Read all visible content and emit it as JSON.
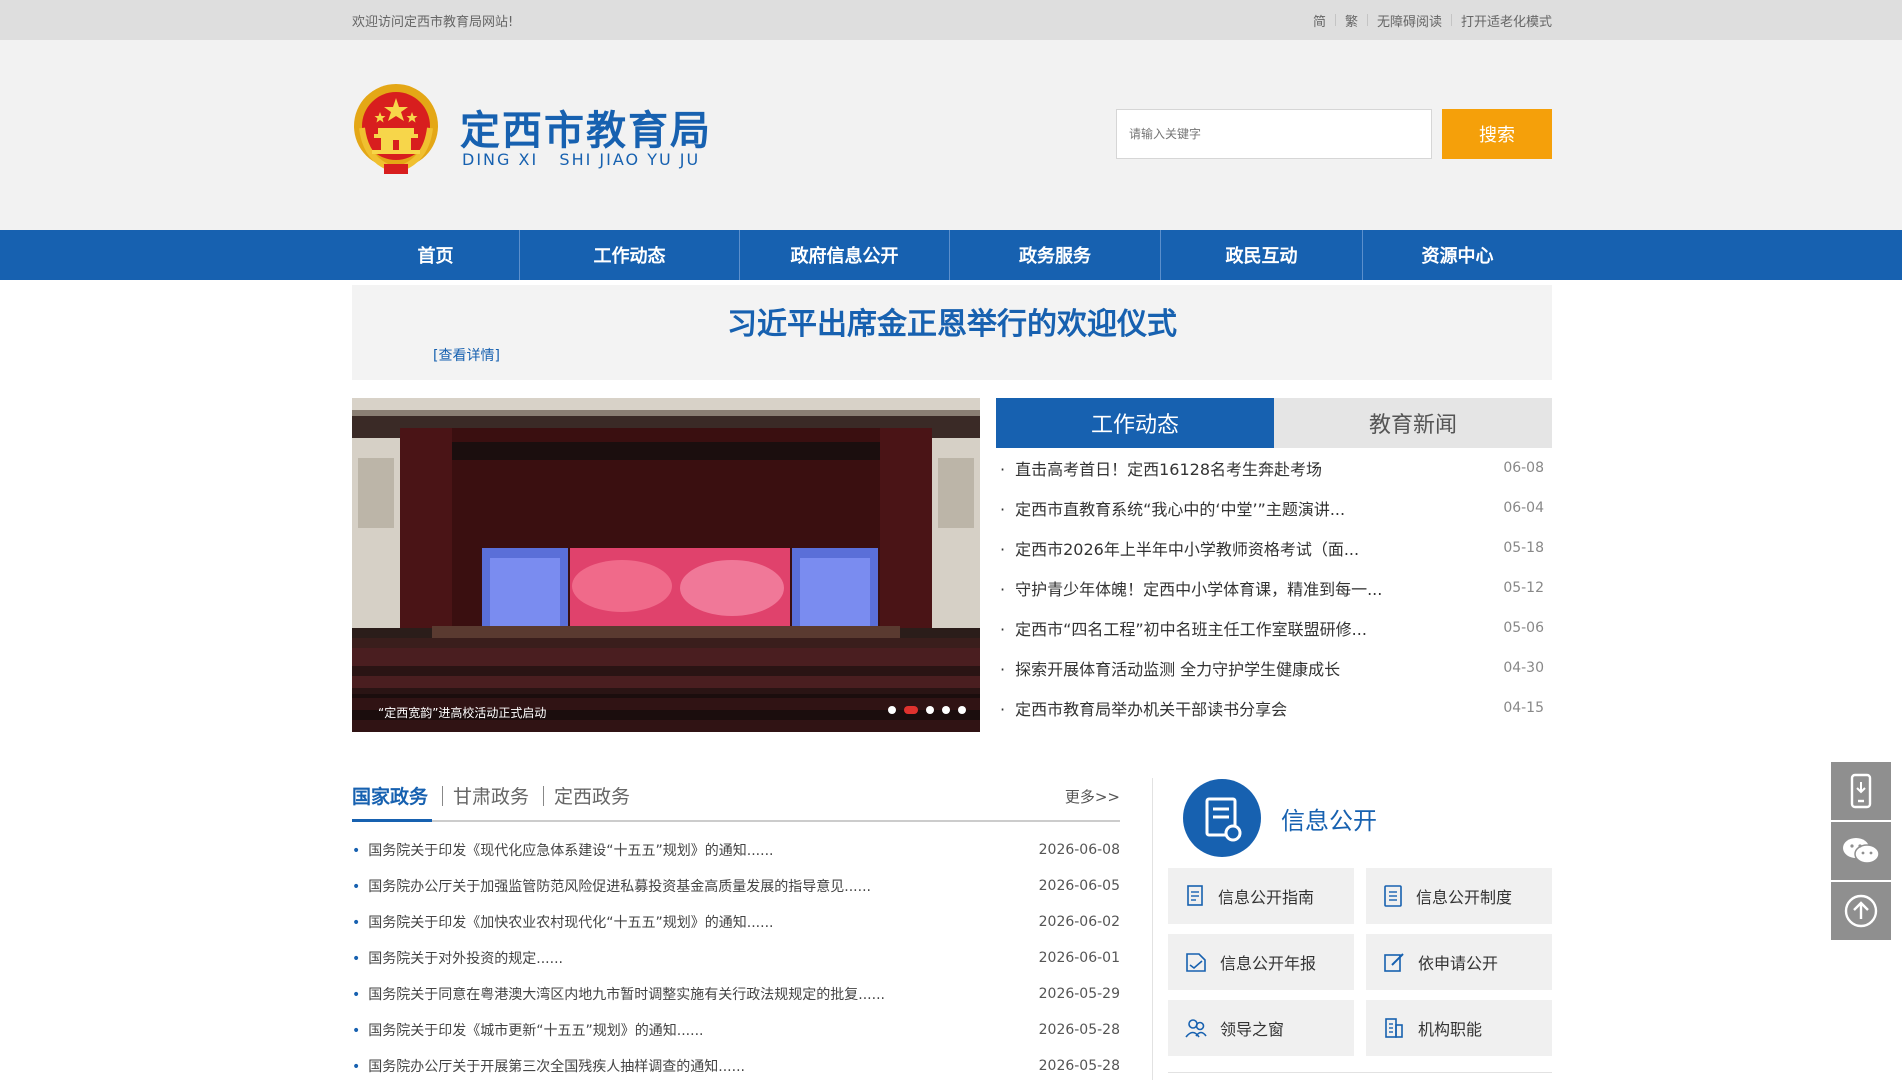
{
  "topbar": {
    "welcome": "欢迎访问定西市教育局网站!",
    "links": [
      "简",
      "繁",
      "无障碍阅读",
      "打开适老化模式"
    ]
  },
  "header": {
    "title": "定西市教育局",
    "pinyin": "DING XI   SHI JIAO YU JU",
    "search_placeholder": "请输入关键字",
    "search_button": "搜索"
  },
  "nav": {
    "items": [
      "首页",
      "工作动态",
      "政府信息公开",
      "政务服务",
      "政民互动",
      "资源中心"
    ]
  },
  "headline": {
    "title": "习近平出席金正恩举行的欢迎仪式",
    "more": "[查看详情]"
  },
  "slider": {
    "caption": "“定西宽韵”进高校活动正式启动",
    "active_index": 1,
    "dot_count": 5
  },
  "news_tabs": {
    "active": "工作动态",
    "inactive": "教育新闻"
  },
  "news": [
    {
      "title": "直击高考首日！定西16128名考生奔赴考场",
      "date": "06-08"
    },
    {
      "title": "定西市直教育系统“我心中的‘中堂’”主题演讲...",
      "date": "06-04"
    },
    {
      "title": "定西市2026年上半年中小学教师资格考试（面...",
      "date": "05-18"
    },
    {
      "title": "守护青少年体魄！定西中小学体育课，精准到每一...",
      "date": "05-12"
    },
    {
      "title": "定西市“四名工程”初中名班主任工作室联盟研修...",
      "date": "05-06"
    },
    {
      "title": "探索开展体育活动监测 全力守护学生健康成长",
      "date": "04-30"
    },
    {
      "title": "定西市教育局举办机关干部读书分享会",
      "date": "04-15"
    }
  ],
  "policy": {
    "tabs": [
      "国家政务",
      "甘肃政务",
      "定西政务"
    ],
    "more": "更多>>",
    "items": [
      {
        "title": "国务院关于印发《现代化应急体系建设“十五五”规划》的通知......",
        "date": "2026-06-08"
      },
      {
        "title": "国务院办公厅关于加强监管防范风险促进私募投资基金高质量发展的指导意见......",
        "date": "2026-06-05"
      },
      {
        "title": "国务院关于印发《加快农业农村现代化“十五五”规划》的通知......",
        "date": "2026-06-02"
      },
      {
        "title": "国务院关于对外投资的规定......",
        "date": "2026-06-01"
      },
      {
        "title": "国务院关于同意在粤港澳大湾区内地九市暂时调整实施有关行政法规规定的批复......",
        "date": "2026-05-29"
      },
      {
        "title": "国务院关于印发《城市更新“十五五”规划》的通知......",
        "date": "2026-05-28"
      },
      {
        "title": "国务院办公厅关于开展第三次全国残疾人抽样调查的通知......",
        "date": "2026-05-28"
      }
    ]
  },
  "info": {
    "title": "信息公开",
    "buttons": [
      {
        "label": "信息公开指南",
        "icon": "guide-icon"
      },
      {
        "label": "信息公开制度",
        "icon": "document-icon"
      },
      {
        "label": "信息公开年报",
        "icon": "report-icon"
      },
      {
        "label": "依申请公开",
        "icon": "edit-icon"
      },
      {
        "label": "领导之窗",
        "icon": "leaders-icon"
      },
      {
        "label": "机构职能",
        "icon": "building-icon"
      }
    ]
  },
  "colors": {
    "brand_blue": "#1761b0",
    "search_orange": "#f5a00a",
    "side_gray": "#8f8f8f"
  }
}
